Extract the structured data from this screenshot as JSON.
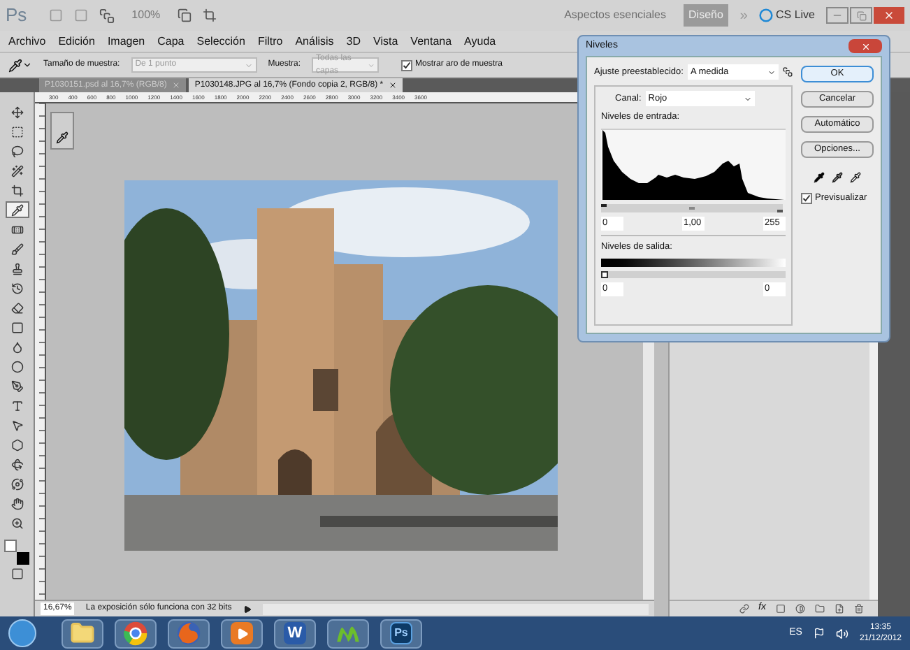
{
  "app_bar": {
    "logo": "Ps",
    "zoom": "100%",
    "workspaces": [
      {
        "label": "Aspectos esenciales",
        "selected": false
      },
      {
        "label": "Diseño",
        "selected": true
      }
    ],
    "more": "»",
    "cs_live": "CS Live"
  },
  "menu": [
    "Archivo",
    "Edición",
    "Imagen",
    "Capa",
    "Selección",
    "Filtro",
    "Análisis",
    "3D",
    "Vista",
    "Ventana",
    "Ayuda"
  ],
  "options_bar": {
    "sample_size_label": "Tamaño de muestra:",
    "sample_size": "De 1 punto",
    "sample_label": "Muestra:",
    "sample": "Todas las capas",
    "show_ring": {
      "label": "Mostrar aro de muestra",
      "checked": true
    }
  },
  "document_tabs": [
    {
      "label": "P1030151.psd al 16,7% (RGB/8)",
      "selected": false
    },
    {
      "label": "P1030148.JPG al 16,7% (Fondo copia 2, RGB/8) *",
      "selected": true
    }
  ],
  "ruler_labels": [
    "300",
    "400",
    "600",
    "800",
    "1000",
    "1200",
    "1400",
    "1600",
    "1800",
    "2000",
    "2200",
    "2400",
    "2600",
    "2800",
    "3000",
    "3200",
    "3400",
    "3600"
  ],
  "tools": [
    {
      "kind": "move",
      "selected": false
    },
    {
      "kind": "marquee",
      "selected": false
    },
    {
      "kind": "lasso",
      "selected": false
    },
    {
      "kind": "wand",
      "selected": false
    },
    {
      "kind": "crop",
      "selected": false
    },
    {
      "kind": "eyedropper",
      "selected": true
    },
    {
      "kind": "healing",
      "selected": false
    },
    {
      "kind": "brush",
      "selected": false
    },
    {
      "kind": "stamp",
      "selected": false
    },
    {
      "kind": "history",
      "selected": false
    },
    {
      "kind": "eraser",
      "selected": false
    },
    {
      "kind": "gradient",
      "selected": false
    },
    {
      "kind": "blur",
      "selected": false
    },
    {
      "kind": "dodge",
      "selected": false
    },
    {
      "kind": "pen",
      "selected": false
    },
    {
      "kind": "type",
      "selected": false
    },
    {
      "kind": "select",
      "selected": false
    },
    {
      "kind": "shape",
      "selected": false
    },
    {
      "kind": "rotate3d",
      "selected": false
    },
    {
      "kind": "orbit3d",
      "selected": false
    },
    {
      "kind": "hand",
      "selected": false
    },
    {
      "kind": "zoom",
      "selected": false
    }
  ],
  "dialog": {
    "title": "Niveles",
    "preset_label": "Ajuste preestablecido:",
    "preset": "A medida",
    "channel_label": "Canal:",
    "channel": "Rojo",
    "input_label": "Niveles de entrada:",
    "input_values": [
      "0",
      "1,00",
      "255"
    ],
    "output_label": "Niveles de salida:",
    "input_sliders": [
      {
        "level": 0
      },
      {
        "level": 0.5
      },
      {
        "level": 1
      }
    ],
    "output_values": [
      "0",
      "0"
    ],
    "output_sliders": [
      {
        "level": 0
      }
    ],
    "buttons": [
      {
        "label": "OK",
        "default": true
      },
      {
        "label": "Cancelar",
        "default": false
      },
      {
        "label": "Automático",
        "default": false
      },
      {
        "label": "Opciones...",
        "default": false
      }
    ],
    "preview": {
      "label": "Previsualizar",
      "checked": true
    }
  },
  "layers_footer": {
    "fx": "fx"
  },
  "status_bar": {
    "zoom": "16,67%",
    "message": "La exposición sólo funciona con 32 bits"
  },
  "taskbar": {
    "apps": [
      {
        "kind": "folder"
      },
      {
        "kind": "chrome"
      },
      {
        "kind": "firefox"
      },
      {
        "kind": "media"
      },
      {
        "kind": "word",
        "label": "W"
      },
      {
        "kind": "movistar"
      },
      {
        "kind": "photoshop",
        "label": "Ps"
      }
    ],
    "language": "ES",
    "time": "13:35",
    "date": "21/12/2012"
  }
}
